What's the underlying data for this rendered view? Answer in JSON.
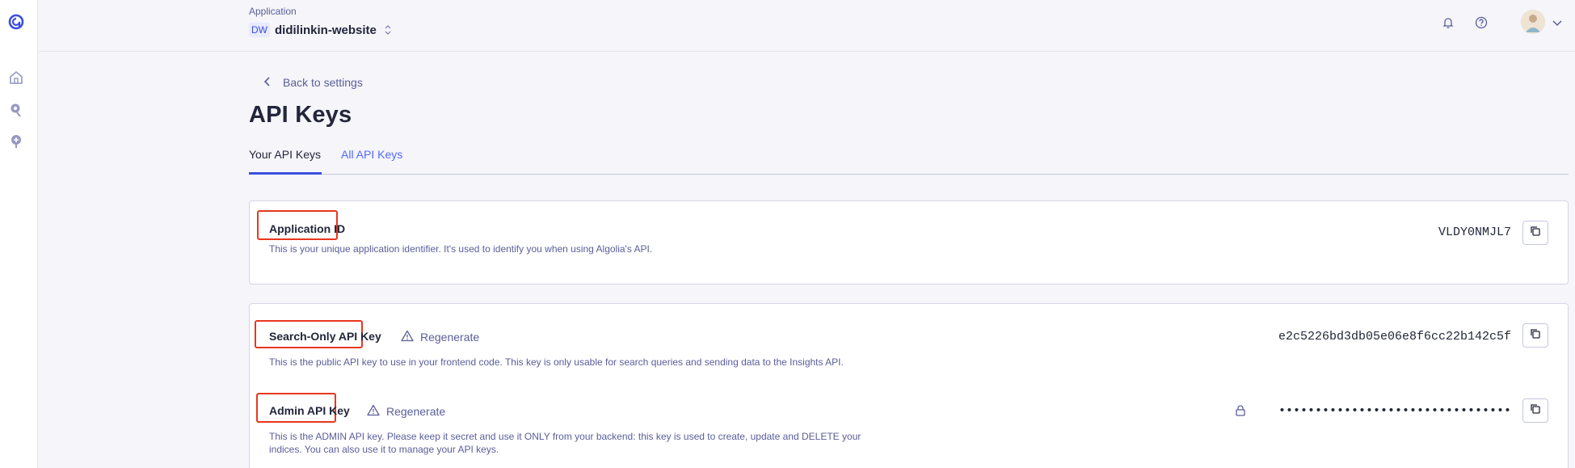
{
  "header": {
    "app_label": "Application",
    "app_badge": "DW",
    "app_name": "didilinkin-website"
  },
  "page": {
    "back_label": "Back to settings",
    "title": "API Keys",
    "tabs": [
      {
        "label": "Your API Keys",
        "active": true
      },
      {
        "label": "All API Keys",
        "active": false
      }
    ]
  },
  "keys": {
    "app_id": {
      "title": "Application ID",
      "description": "This is your unique application identifier. It's used to identify you when using Algolia's API.",
      "value": "VLDY0NMJL7"
    },
    "search_only": {
      "title": "Search-Only API Key",
      "regenerate_label": "Regenerate",
      "description": "This is the public API key to use in your frontend code. This key is only usable for search queries and sending data to the Insights API.",
      "value": "e2c5226bd3db05e06e8f6cc22b142c5f"
    },
    "admin": {
      "title": "Admin API Key",
      "regenerate_label": "Regenerate",
      "description_line1": "This is the ADMIN API key. Please keep it secret and use it ONLY from your backend: this key is used to create, update and DELETE your",
      "description_line2": "indices. You can also use it to manage your API keys.",
      "value": "••••••••••••••••••••••••••••••••"
    }
  },
  "colors": {
    "accent": "#3c4fe0",
    "link": "#5468ff",
    "highlight": "#e8371e"
  },
  "icons": [
    "algolia-logo-icon",
    "home-icon",
    "search-pin-icon",
    "add-pin-icon",
    "chevron-left-icon",
    "bell-icon",
    "help-icon",
    "chevron-down-icon",
    "warning-icon",
    "lock-icon",
    "copy-icon"
  ]
}
